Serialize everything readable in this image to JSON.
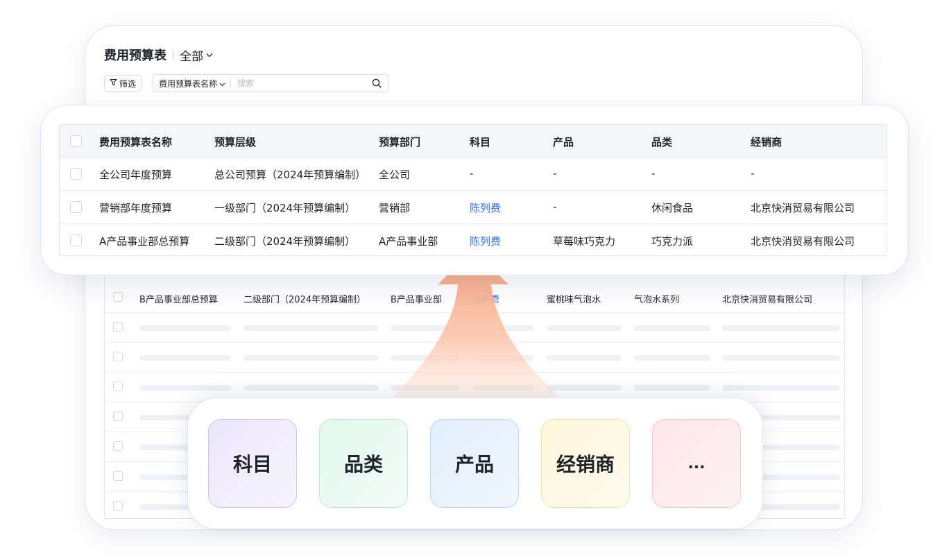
{
  "header": {
    "title": "费用预算表",
    "scope": "全部",
    "scope_chevron": "⌄"
  },
  "toolbar": {
    "filter_icon": "filter-icon",
    "filter_label": "筛选",
    "search_field": "费用预算表名称",
    "search_placeholder": "搜索",
    "search_icon": "search-icon"
  },
  "main_table": {
    "columns": [
      "费用预算表名称",
      "预算层级",
      "预算部门",
      "科目",
      "产品",
      "品类",
      "经销商"
    ],
    "rows": [
      [
        "全公司年度预算",
        "总公司预算（2024年预算编制）",
        "全公司",
        "-",
        "-",
        "-",
        "-"
      ],
      [
        "营销部年度预算",
        "一级部门（2024年预算编制）",
        "营销部",
        "陈列费",
        "-",
        "休闲食品",
        "北京快消贸易有限公司"
      ],
      [
        "A产品事业部总预算",
        "二级部门（2024年预算编制）",
        "A产品事业部",
        "陈列费",
        "草莓味巧克力",
        "巧克力派",
        "北京快消贸易有限公司"
      ]
    ]
  },
  "back_table": {
    "rows": [
      [
        "B产品事业部总预算",
        "二级部门（2024年预算编制）",
        "B产品事业部",
        "返利费",
        "蜜桃味气泡水",
        "气泡水系列",
        "北京快消贸易有限公司"
      ]
    ]
  },
  "dimensions": {
    "tiles": [
      "科目",
      "品类",
      "产品",
      "经销商",
      "..."
    ]
  },
  "colors": {
    "link": "#3370ff",
    "arrow_top": "#f9a07a",
    "arrow_bottom": "#fde3d6"
  }
}
